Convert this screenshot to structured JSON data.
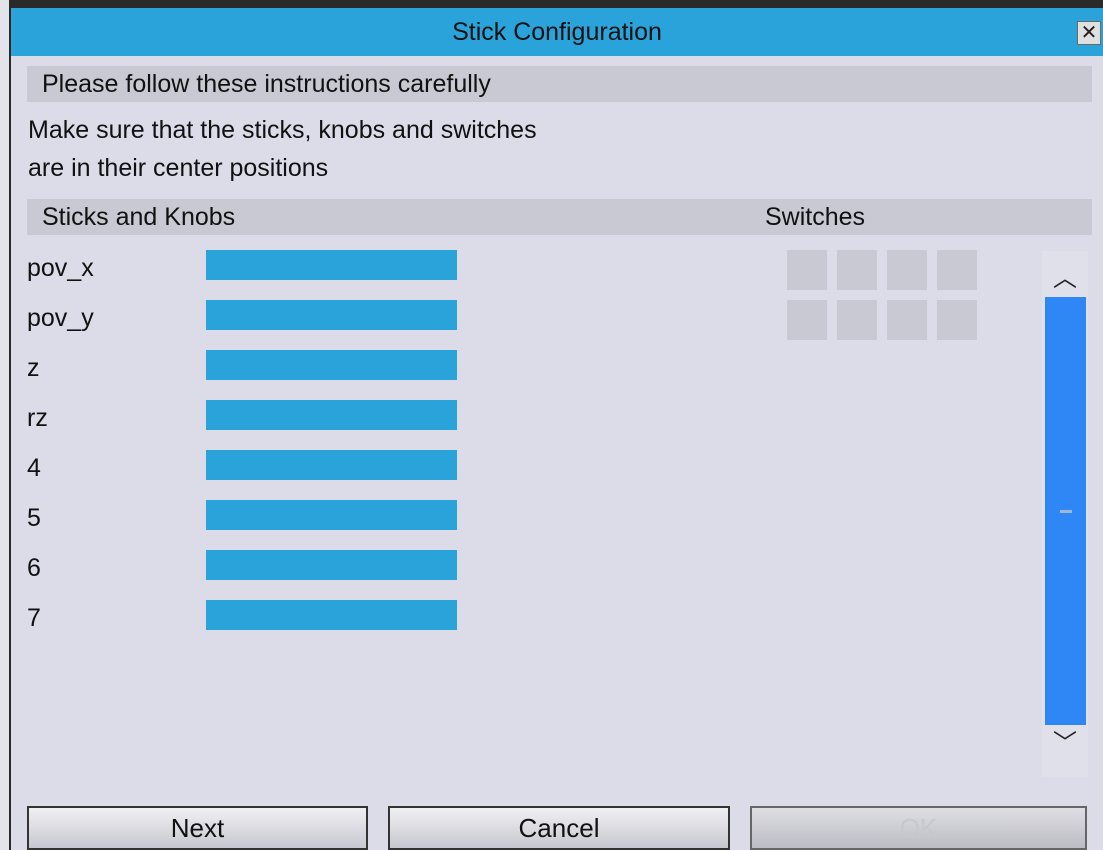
{
  "window": {
    "title": "Stick Configuration",
    "close_glyph": "✕"
  },
  "instructions": {
    "header": "Please follow these instructions carefully",
    "line1": "Make sure that the sticks, knobs and switches",
    "line2": "are in their center positions"
  },
  "columns": {
    "sticks_header": "Sticks and Knobs",
    "switches_header": "Switches"
  },
  "axes": [
    {
      "label": "pov_x"
    },
    {
      "label": "pov_y"
    },
    {
      "label": "z"
    },
    {
      "label": "rz"
    },
    {
      "label": "4"
    },
    {
      "label": "5"
    },
    {
      "label": "6"
    },
    {
      "label": "7"
    }
  ],
  "switches": {
    "rows": 2,
    "per_row": 4,
    "states": [
      "off",
      "off",
      "off",
      "off",
      "off",
      "off",
      "off",
      "off"
    ]
  },
  "scrollbar": {
    "up_glyph": "︿",
    "down_glyph": "﹀",
    "thumb_color": "#2f87f5"
  },
  "buttons": {
    "next_label": "Next",
    "cancel_label": "Cancel",
    "ok_label": "OK"
  },
  "colors": {
    "titlebar": "#29a3d9",
    "axis_bar": "#29a3d9",
    "section_bar": "#c9c9d3",
    "background": "#dcdce8"
  }
}
